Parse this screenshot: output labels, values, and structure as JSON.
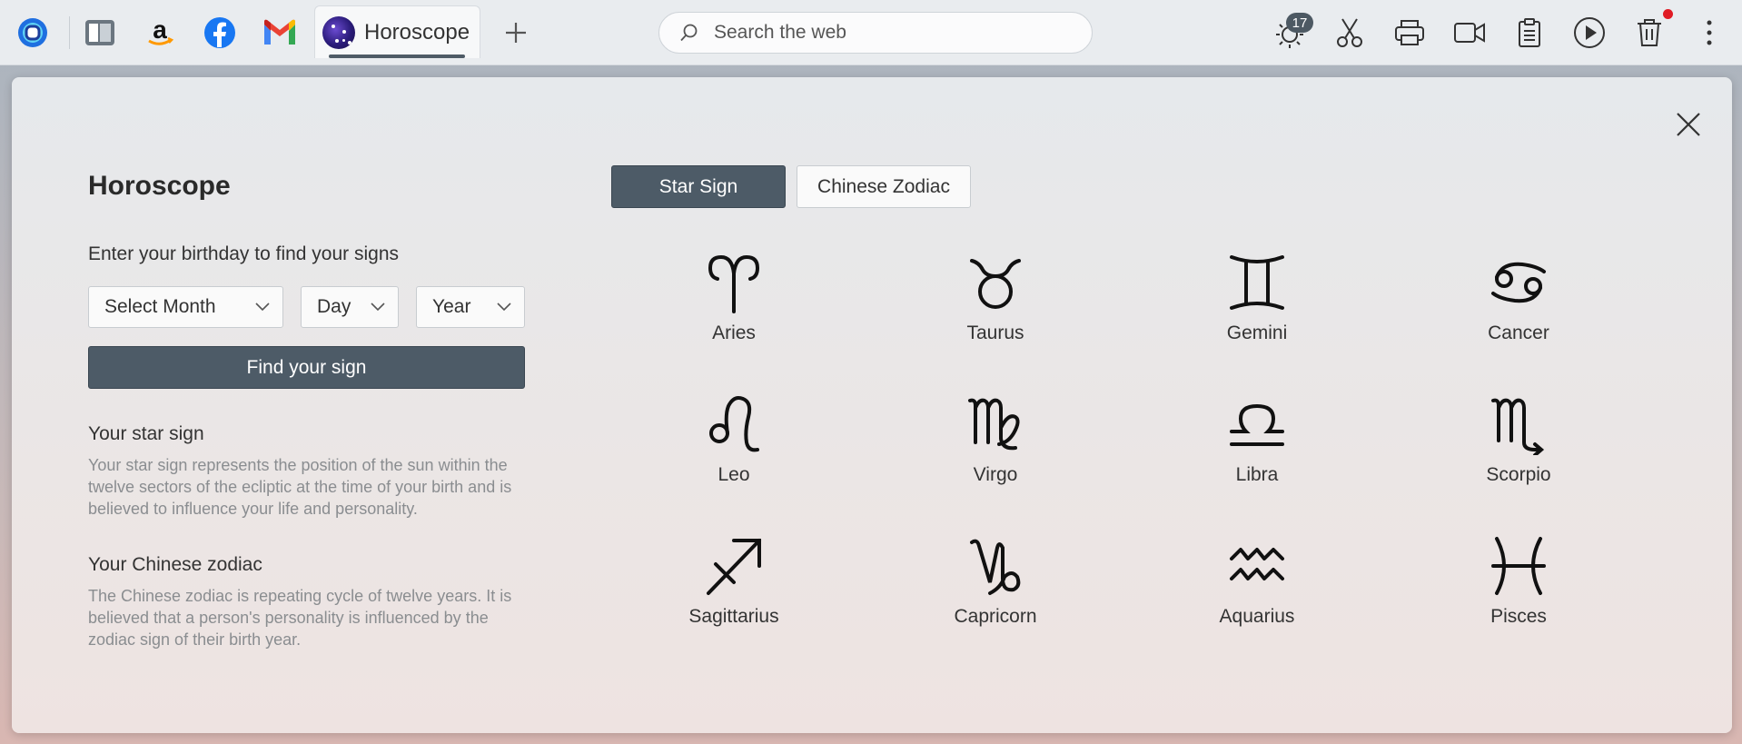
{
  "browser": {
    "active_tab": {
      "title": "Horoscope"
    },
    "search": {
      "placeholder": "Search the web"
    },
    "notification_count": "17"
  },
  "panel": {
    "title": "Horoscope",
    "prompt": "Enter your birthday to find your signs",
    "selects": {
      "month": "Select Month",
      "day": "Day",
      "year": "Year"
    },
    "find_button": "Find your sign",
    "star_sign": {
      "heading": "Your star sign",
      "text": "Your star sign represents the position of the sun within the twelve sectors of the ecliptic at the time of your birth and is believed to influence your life and personality."
    },
    "chinese_zodiac": {
      "heading": "Your Chinese zodiac",
      "text": "The Chinese zodiac is repeating cycle of twelve years. It is believed that a person's personality is influenced by the zodiac sign of their birth year."
    },
    "tabs": {
      "star": "Star Sign",
      "chinese": "Chinese Zodiac"
    },
    "signs": [
      "Aries",
      "Taurus",
      "Gemini",
      "Cancer",
      "Leo",
      "Virgo",
      "Libra",
      "Scorpio",
      "Sagittarius",
      "Capricorn",
      "Aquarius",
      "Pisces"
    ]
  }
}
